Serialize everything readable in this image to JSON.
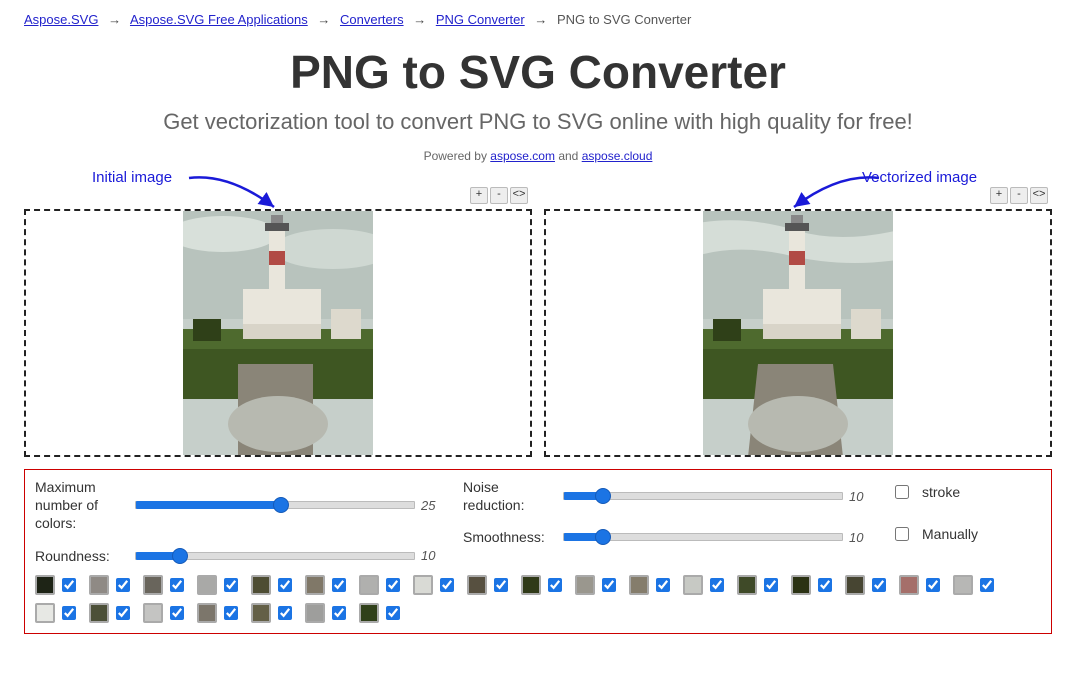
{
  "breadcrumb": {
    "items": [
      {
        "label": "Aspose.SVG",
        "link": true
      },
      {
        "label": "Aspose.SVG Free Applications",
        "link": true
      },
      {
        "label": "Converters",
        "link": true
      },
      {
        "label": "PNG Converter",
        "link": true
      },
      {
        "label": "PNG to SVG Converter",
        "link": false
      }
    ]
  },
  "header": {
    "title": "PNG to SVG Converter",
    "subtitle": "Get vectorization tool to convert PNG to SVG online with high quality for free!",
    "powered_prefix": "Powered by ",
    "powered_link1": "aspose.com",
    "powered_and": " and ",
    "powered_link2": "aspose.cloud"
  },
  "annotations": {
    "initial_label": "Initial image",
    "vectorized_label": "Vectorized image"
  },
  "zoom": {
    "plus": "+",
    "minus": "-",
    "swap": "<>"
  },
  "controls": {
    "max_colors_label": "Maximum number of colors:",
    "max_colors_value": "25",
    "max_colors_pct": 52,
    "roundness_label": "Roundness:",
    "roundness_value": "10",
    "roundness_pct": 16,
    "noise_label": "Noise reduction:",
    "noise_value": "10",
    "noise_pct": 14,
    "smooth_label": "Smoothness:",
    "smooth_value": "10",
    "smooth_pct": 14,
    "stroke_label": "stroke",
    "stroke_checked": false,
    "manually_label": "Manually",
    "manually_checked": false
  },
  "swatches": [
    {
      "color": "#1e2416",
      "checked": true
    },
    {
      "color": "#8f8a85",
      "checked": true
    },
    {
      "color": "#69655c",
      "checked": true
    },
    {
      "color": "#a9a9a7",
      "checked": true
    },
    {
      "color": "#4e4d33",
      "checked": true
    },
    {
      "color": "#807868",
      "checked": true
    },
    {
      "color": "#b0b0ae",
      "checked": true
    },
    {
      "color": "#d9dad5",
      "checked": true
    },
    {
      "color": "#575040",
      "checked": true
    },
    {
      "color": "#303a18",
      "checked": true
    },
    {
      "color": "#9a978e",
      "checked": true
    },
    {
      "color": "#857d6c",
      "checked": true
    },
    {
      "color": "#c7c9c4",
      "checked": true
    },
    {
      "color": "#3f4a28",
      "checked": true
    },
    {
      "color": "#2b3213",
      "checked": true
    },
    {
      "color": "#474532",
      "checked": true
    },
    {
      "color": "#a56f6a",
      "checked": true
    },
    {
      "color": "#b7b7b5",
      "checked": true
    },
    {
      "color": "#e7e8e4",
      "checked": true
    },
    {
      "color": "#4c5038",
      "checked": true
    },
    {
      "color": "#c4c4c2",
      "checked": true
    },
    {
      "color": "#7c766b",
      "checked": true
    },
    {
      "color": "#646047",
      "checked": true
    },
    {
      "color": "#9e9e9c",
      "checked": true
    },
    {
      "color": "#30401a",
      "checked": true
    }
  ]
}
